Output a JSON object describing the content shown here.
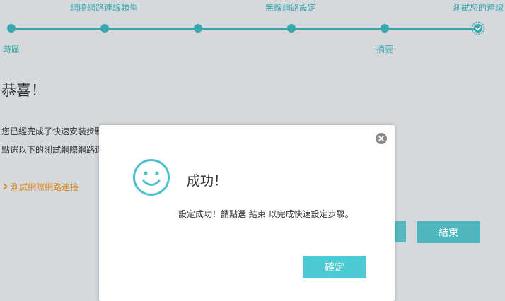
{
  "wizard": {
    "steps_top": [
      "網際網路連線類型",
      "無線網路設定",
      "測試您的連線"
    ],
    "steps_bottom": [
      "時區",
      "摘要"
    ]
  },
  "main": {
    "congrats": "恭喜！",
    "line1": "您已經完成了快速安裝步驟",
    "line2": "點選以下的測試網際網路連",
    "test_link": "測試網際網路連接",
    "finish_label": "結束"
  },
  "modal": {
    "title": "成功！",
    "message": "設定成功！請點選 結束 以完成快速設定步驟。",
    "confirm_label": "確定"
  },
  "colors": {
    "accent": "#3aa6ad",
    "link": "#d98a2b",
    "button": "#4dcad4"
  },
  "icons": [
    "check-circle-icon",
    "close-icon",
    "smiley-icon",
    "chevron-right-icon"
  ]
}
